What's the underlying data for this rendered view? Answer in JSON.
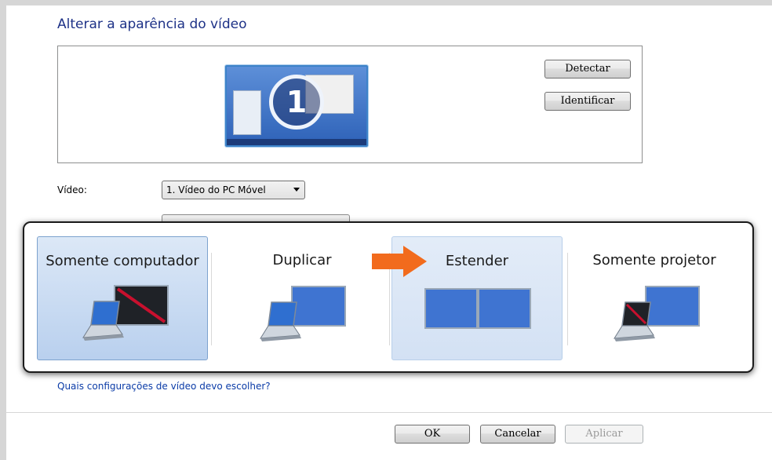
{
  "dialog": {
    "title": "Alterar a aparência do vídeo",
    "monitor_number": "1",
    "detect_button": "Detectar",
    "identify_button": "Identificar",
    "display_label": "Vídeo:",
    "display_value": "1. Vídeo do PC Móvel",
    "help_link": "Quais configurações de vídeo devo escolher?",
    "ok_button": "OK",
    "cancel_button": "Cancelar",
    "apply_button": "Aplicar"
  },
  "switcher": {
    "options": [
      {
        "label": "Somente computador",
        "icon": "computer-only-icon",
        "state": "selected"
      },
      {
        "label": "Duplicar",
        "icon": "duplicate-icon",
        "state": "normal"
      },
      {
        "label": "Estender",
        "icon": "extend-icon",
        "state": "highlighted"
      },
      {
        "label": "Somente projetor",
        "icon": "projector-only-icon",
        "state": "normal"
      }
    ],
    "pointer": "arrow-right-icon"
  },
  "colors": {
    "title": "#1e3287",
    "link": "#0a3ba7",
    "arrow": "#f26b1d",
    "screen_blue": "#4a7fd6",
    "off_line": "#c8102e"
  }
}
